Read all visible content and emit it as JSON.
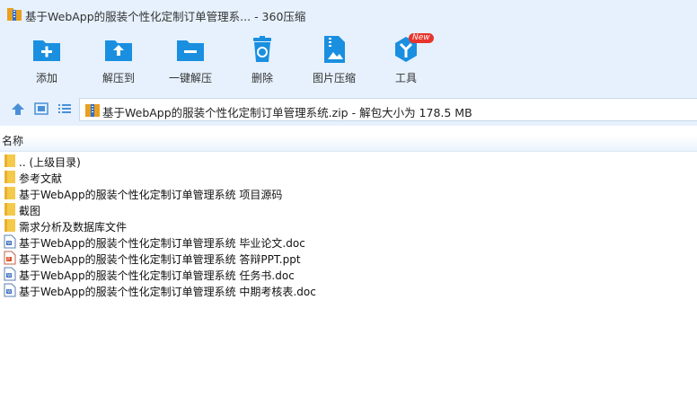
{
  "window": {
    "title": "基于WebApp的服装个性化定制订单管理系... - 360压缩"
  },
  "toolbar": {
    "items": [
      {
        "label": "添加",
        "icon": "add-icon"
      },
      {
        "label": "解压到",
        "icon": "extract-to-icon"
      },
      {
        "label": "一键解压",
        "icon": "one-click-extract-icon"
      },
      {
        "label": "删除",
        "icon": "delete-icon"
      },
      {
        "label": "图片压缩",
        "icon": "image-compress-icon"
      },
      {
        "label": "工具",
        "icon": "tools-icon",
        "badge": "New"
      }
    ]
  },
  "address": {
    "path": "基于WebApp的服装个性化定制订单管理系统.zip - 解包大小为 178.5 MB"
  },
  "list": {
    "column_name": "名称",
    "rows": [
      {
        "name": ".. (上级目录)",
        "type": "folder"
      },
      {
        "name": "参考文献",
        "type": "folder"
      },
      {
        "name": "基于WebApp的服装个性化定制订单管理系统 项目源码",
        "type": "folder"
      },
      {
        "name": "截图",
        "type": "folder"
      },
      {
        "name": "需求分析及数据库文件",
        "type": "folder"
      },
      {
        "name": "基于WebApp的服装个性化定制订单管理系统 毕业论文.doc",
        "type": "doc"
      },
      {
        "name": "基于WebApp的服装个性化定制订单管理系统 答辩PPT.ppt",
        "type": "ppt"
      },
      {
        "name": "基于WebApp的服装个性化定制订单管理系统 任务书.doc",
        "type": "doc"
      },
      {
        "name": "基于WebApp的服装个性化定制订单管理系统 中期考核表.doc",
        "type": "doc"
      }
    ]
  },
  "colors": {
    "accent": "#1a8fe0",
    "chrome_bg": "#e6f1fd",
    "folder": "#f5c94a",
    "badge": "#e8342c"
  }
}
